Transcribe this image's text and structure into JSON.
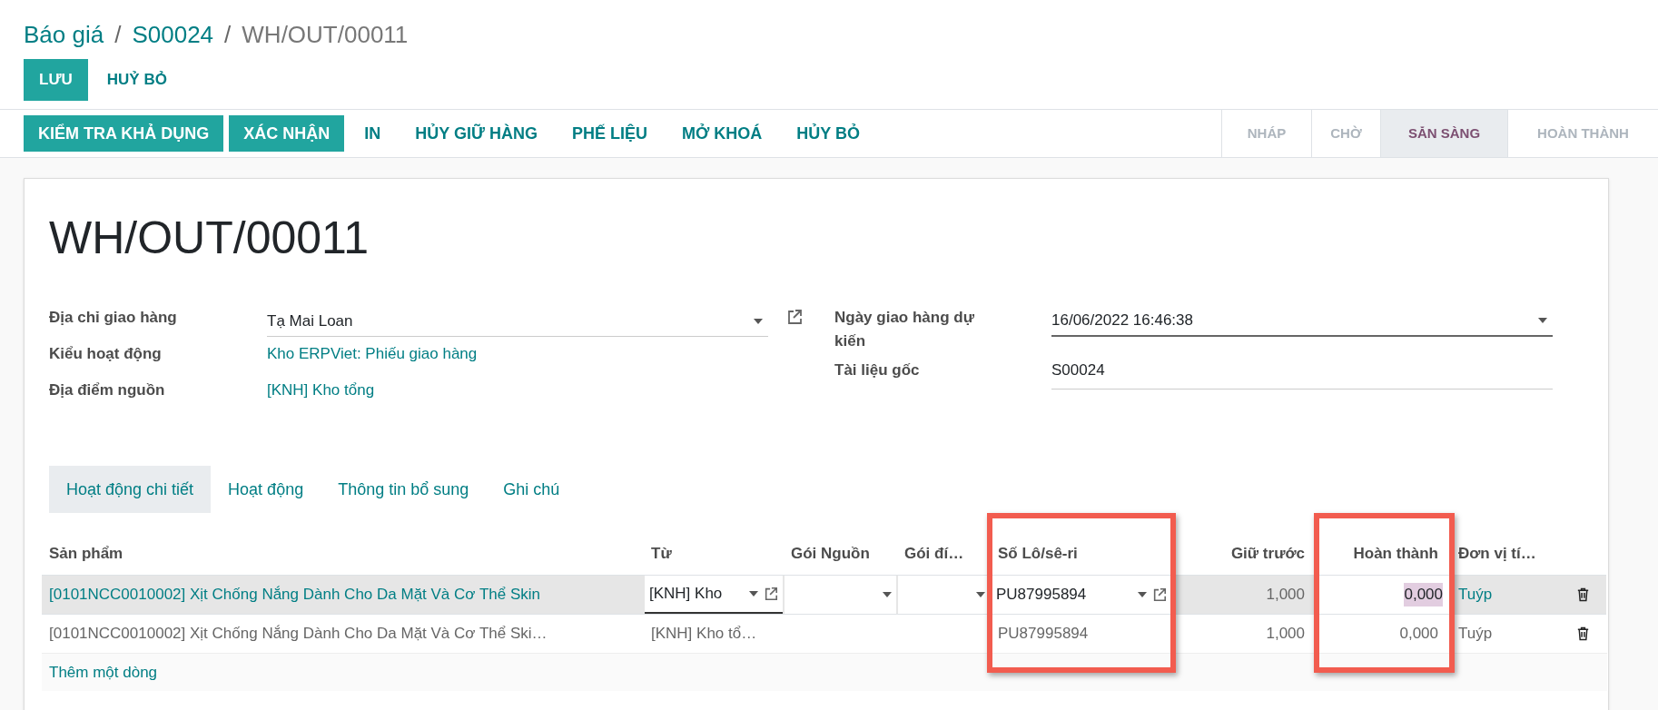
{
  "breadcrumb": [
    {
      "text": "Báo giá",
      "kind": "link"
    },
    {
      "text": "/",
      "kind": "separator"
    },
    {
      "text": "S00024",
      "kind": "link"
    },
    {
      "text": "/",
      "kind": "separator"
    },
    {
      "text": "WH/OUT/00011",
      "kind": "current"
    }
  ],
  "edit_buttons": [
    {
      "label": "LƯU",
      "primary": true
    },
    {
      "label": "HUỶ BỎ",
      "primary": false
    }
  ],
  "actions": [
    {
      "label": "KIỂM TRA KHẢ DỤNG",
      "primary": true
    },
    {
      "label": "XÁC NHẬN",
      "primary": true
    },
    {
      "label": "IN",
      "primary": false
    },
    {
      "label": "HỦY GIỮ HÀNG",
      "primary": false
    },
    {
      "label": "PHẾ LIỆU",
      "primary": false
    },
    {
      "label": "MỞ KHOÁ",
      "primary": false
    },
    {
      "label": "HỦY BỎ",
      "primary": false
    }
  ],
  "stages": [
    {
      "label": "NHÁP",
      "selected": false
    },
    {
      "label": "CHỜ",
      "selected": false
    },
    {
      "label": "SẴN SÀNG",
      "selected": true
    },
    {
      "label": "HOÀN THÀNH",
      "selected": false
    }
  ],
  "record_title": "WH/OUT/00011",
  "left_fields": [
    {
      "label": "Địa chỉ giao hàng",
      "value": "Tạ Mai Loan",
      "kind": "select",
      "external_link": true
    },
    {
      "label": "Kiểu hoạt động",
      "value": "Kho ERPViet: Phiếu giao hàng",
      "kind": "link",
      "external_link": false
    },
    {
      "label": "Địa điểm nguồn",
      "value": "[KNH] Kho tổng",
      "kind": "link",
      "external_link": false
    }
  ],
  "right_fields": [
    {
      "label": "Ngày giao hàng dự kiến",
      "value": "16/06/2022 16:46:38",
      "kind": "select",
      "external_link": false
    },
    {
      "label": "Tài liệu gốc",
      "value": "S00024",
      "kind": "text",
      "external_link": false
    }
  ],
  "tabs": [
    {
      "label": "Hoạt động chi tiết",
      "selected": true
    },
    {
      "label": "Hoạt động",
      "selected": false
    },
    {
      "label": "Thông tin bổ sung",
      "selected": false
    },
    {
      "label": "Ghi chú",
      "selected": false
    }
  ],
  "table": {
    "columns": [
      {
        "label": "Sản phẩm",
        "numeric": false,
        "highlighted": false
      },
      {
        "label": "Từ",
        "numeric": false,
        "highlighted": false
      },
      {
        "label": "Gói Nguồn",
        "numeric": false,
        "highlighted": false
      },
      {
        "label": "Gói đí…",
        "numeric": false,
        "highlighted": false
      },
      {
        "label": "Số Lô/sê-ri",
        "numeric": false,
        "highlighted": true
      },
      {
        "label": "Giữ trước",
        "numeric": true,
        "highlighted": false
      },
      {
        "label": "Hoàn thành",
        "numeric": true,
        "highlighted": true
      },
      {
        "label": "Đơn vị tí…",
        "numeric": false,
        "highlighted": false
      }
    ],
    "rows": [
      {
        "selected": true,
        "deletable": true,
        "cells": [
          {
            "kind": "link",
            "text": "[0101NCC0010002] Xịt Chống Nắng Dành Cho Da Mặt Và Cơ Thể Skin"
          },
          {
            "kind": "input",
            "text": "[KNH] Kho",
            "caret": true,
            "external_link": true
          },
          {
            "kind": "select",
            "caret": true
          },
          {
            "kind": "select",
            "caret": true
          },
          {
            "kind": "select",
            "text": "PU87995894",
            "caret": true,
            "external_link": true
          },
          {
            "kind": "text",
            "text": "1,000"
          },
          {
            "kind": "select",
            "text": "0,000",
            "text_selected": true
          },
          {
            "kind": "link",
            "text": "Tuýp"
          }
        ]
      },
      {
        "selected": false,
        "deletable": true,
        "cells": [
          {
            "kind": "text",
            "text": "[0101NCC0010002] Xịt Chống Nắng Dành Cho Da Mặt Và Cơ Thể Ski…"
          },
          {
            "kind": "text",
            "text": "[KNH] Kho tổ…"
          },
          {
            "kind": "text"
          },
          {
            "kind": "text"
          },
          {
            "kind": "text",
            "text": "PU87995894"
          },
          {
            "kind": "text",
            "text": "1,000"
          },
          {
            "kind": "text",
            "text": "0,000"
          },
          {
            "kind": "text",
            "text": "Tuýp"
          }
        ]
      }
    ],
    "add_line": "Thêm một dòng"
  }
}
